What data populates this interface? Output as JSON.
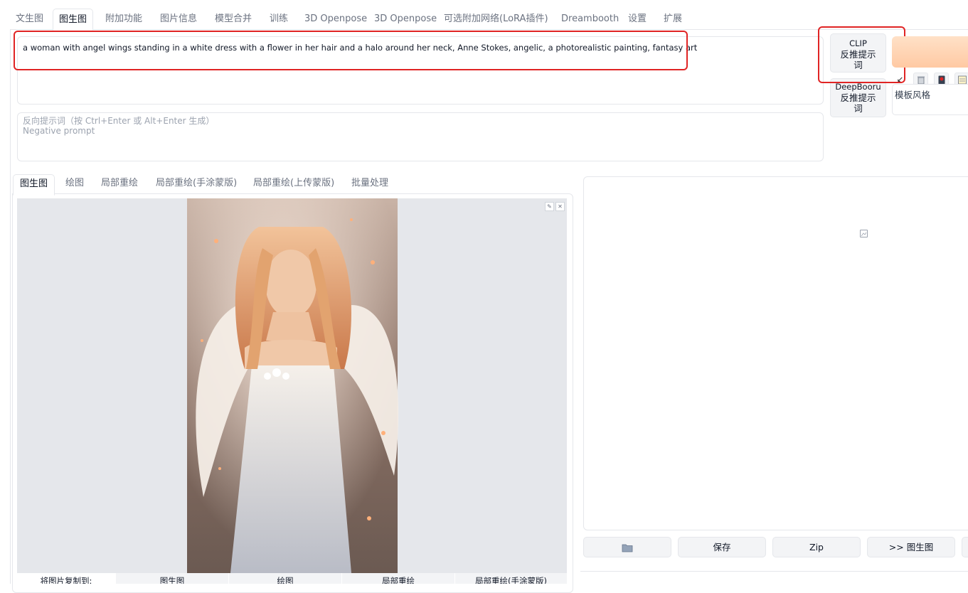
{
  "top_tabs": [
    "文生图",
    "图生图",
    "附加功能",
    "图片信息",
    "模型合并",
    "训练",
    "3D Openpose",
    "3D Openpose",
    "可选附加网络(LoRA插件)",
    "Dreambooth",
    "设置",
    "扩展"
  ],
  "active_top_tab": "图生图",
  "prompt": {
    "value": "a woman with angel wings standing in a white dress with a flower in her hair and a halo around her neck, Anne Stokes, angelic, a photorealistic painting, fantasy art"
  },
  "negative_prompt": {
    "placeholder_line1": "反向提示词（按 Ctrl+Enter 或 Alt+Enter 生成）",
    "placeholder_line2": "Negative prompt"
  },
  "buttons": {
    "clip_line1": "CLIP",
    "clip_line2": "反推提示",
    "clip_line3": "词",
    "deepbooru_line1": "DeepBooru",
    "deepbooru_line2": "反推提示",
    "deepbooru_line3": "词"
  },
  "style_label": "模板风格",
  "sub_tabs": [
    "图生图",
    "绘图",
    "局部重绘",
    "局部重绘(手涂蒙版)",
    "局部重绘(上传蒙版)",
    "批量处理"
  ],
  "active_sub_tab": "图生图",
  "copy_row": [
    "将图片复制到:",
    "图生图",
    "绘图",
    "局部重绘",
    "局部重绘(手涂蒙版)"
  ],
  "gallery_buttons": {
    "save": "保存",
    "zip": "Zip",
    "send_img2img": ">> 图生图"
  },
  "icons": {
    "folder": "folder-icon",
    "image_placeholder": "image-icon",
    "edit": "pencil-icon",
    "close": "close-icon"
  },
  "colors": {
    "highlight": "#e02424",
    "generate": "#ffc9a3"
  }
}
